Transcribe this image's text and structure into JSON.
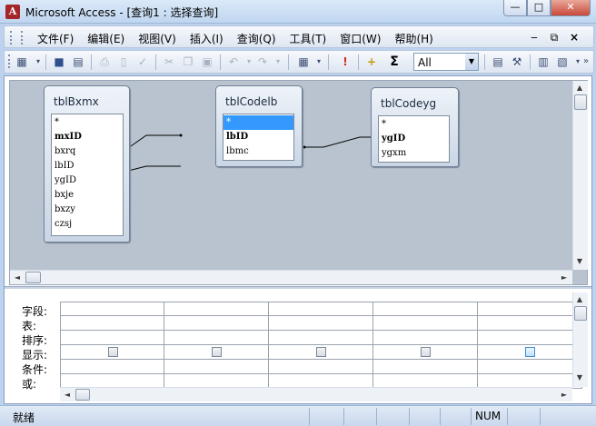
{
  "window": {
    "app_icon_letter": "A",
    "title": "Microsoft Access - [查询1 : 选择查询]",
    "minimize_glyph": "—",
    "maximize_glyph": "□",
    "close_glyph": "✕"
  },
  "menubar": {
    "items": [
      "文件(F)",
      "编辑(E)",
      "视图(V)",
      "插入(I)",
      "查询(Q)",
      "工具(T)",
      "窗口(W)",
      "帮助(H)"
    ],
    "mdi_close": "×",
    "mdi_restore": "⧉",
    "mdi_minimize": "‒"
  },
  "toolbar": {
    "view_glyph": "▦",
    "save_glyph": "■",
    "search_glyph": "▤",
    "print_glyph": "⎙",
    "preview_glyph": "▯",
    "spell_glyph": "✓",
    "cut_glyph": "✂",
    "copy_glyph": "❐",
    "paste_glyph": "▣",
    "undo_glyph": "↶",
    "redo_glyph": "↷",
    "query_type_glyph": "▦",
    "run_glyph": "!",
    "show_table_glyph": "+",
    "totals_glyph": "Σ",
    "top_values": "All",
    "combo_arrow": "▼",
    "properties_glyph": "▤",
    "build_glyph": "⚒",
    "db_window_glyph": "▥",
    "new_object_glyph": "▧",
    "overflow_glyph": "»"
  },
  "tables": [
    {
      "title": "tblBxmx",
      "fields": [
        "*",
        "mxID",
        "bxrq",
        "lbID",
        "ygID",
        "bxje",
        "bxzy",
        "czsj"
      ],
      "pk": [
        1
      ]
    },
    {
      "title": "tblCodelb",
      "fields": [
        "*",
        "lbID",
        "lbmc"
      ],
      "pk": [
        1
      ],
      "selected": 0
    },
    {
      "title": "tblCodeyg",
      "fields": [
        "*",
        "ygID",
        "ygxm"
      ],
      "pk": [
        1
      ]
    }
  ],
  "grid": {
    "row_labels": [
      "字段:",
      "表:",
      "排序:",
      "显示:",
      "条件:",
      "或:"
    ],
    "column_count": 5,
    "highlighted_column": 4
  },
  "scroll": {
    "up": "▲",
    "down": "▼",
    "left": "◄",
    "right": "►"
  },
  "statusbar": {
    "text": "就绪",
    "num": "NUM"
  },
  "colors": {
    "selection": "#3399ff",
    "close_button": "#c8493a",
    "table_pane_bg": "#b9c3d0"
  }
}
